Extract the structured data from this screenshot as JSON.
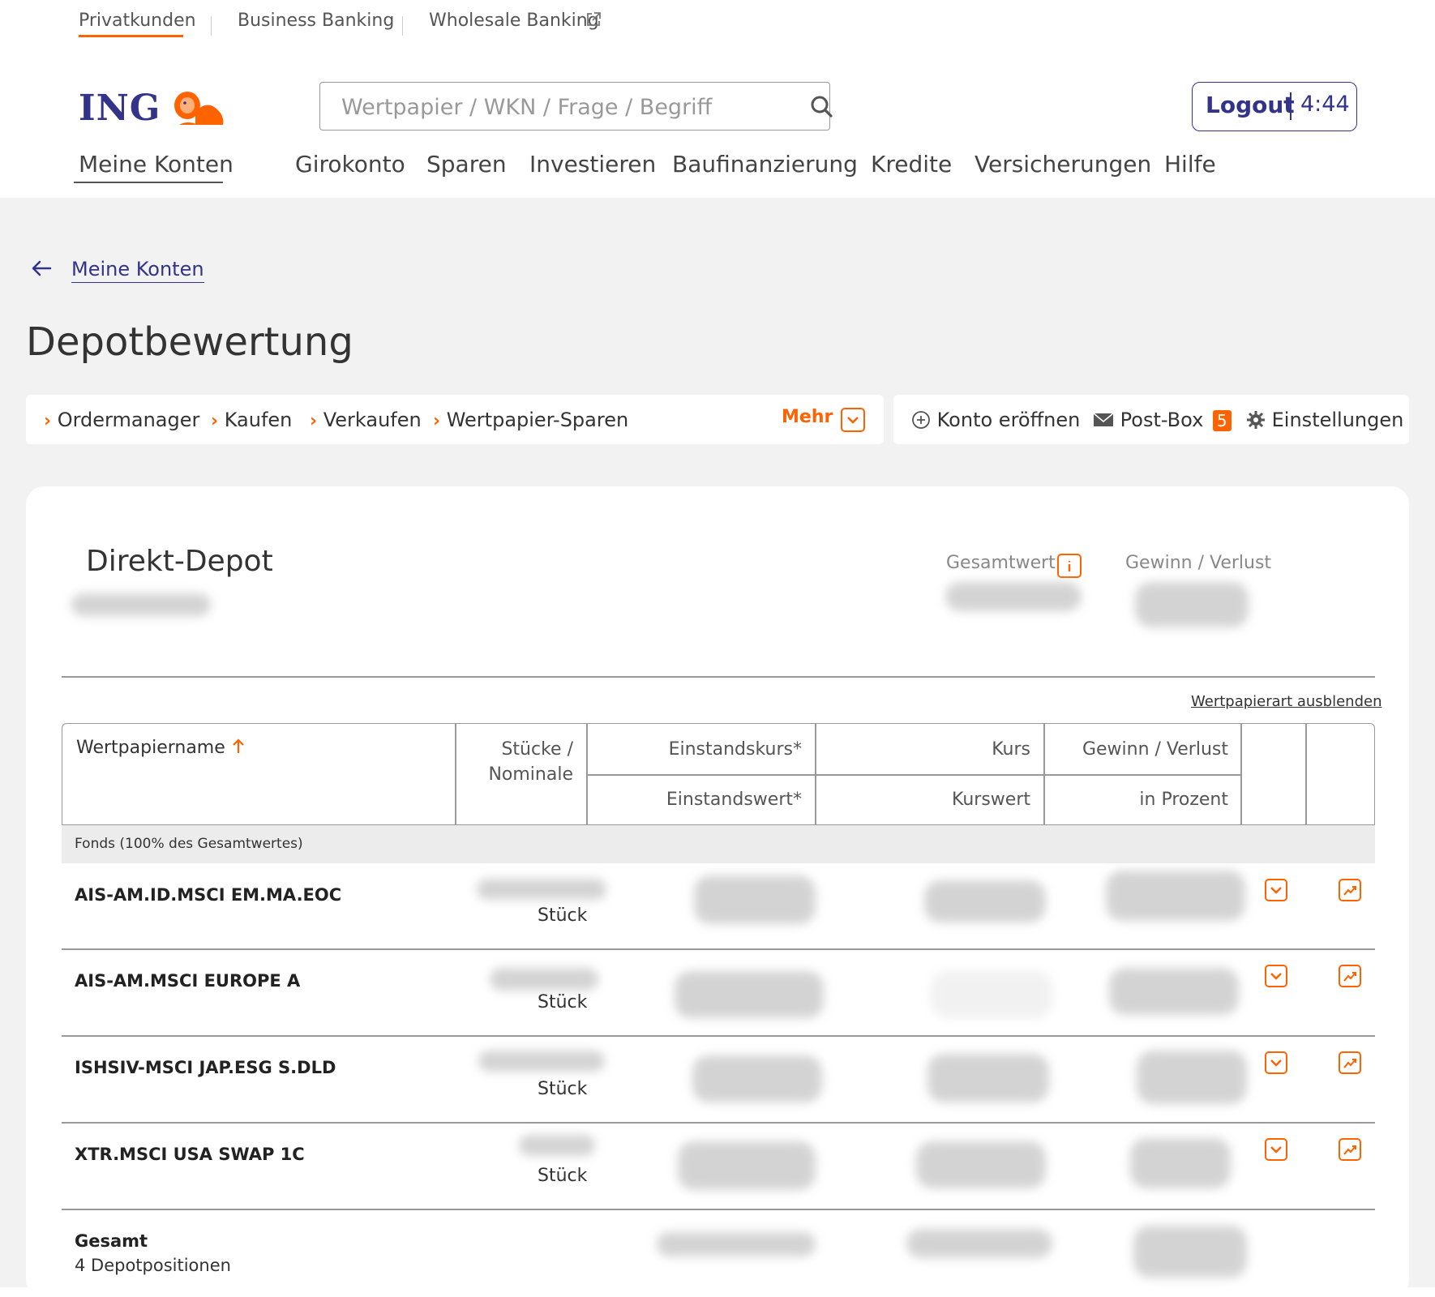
{
  "segments": {
    "privat": "Privatkunden",
    "business": "Business Banking",
    "wholesale": "Wholesale Banking"
  },
  "logo": {
    "text": "ING"
  },
  "search": {
    "placeholder": "Wertpapier / WKN / Frage / Begriff"
  },
  "logout": {
    "label": "Logout",
    "timer": "4:44"
  },
  "nav": {
    "meine_konten": "Meine Konten",
    "items": [
      "Girokonto",
      "Sparen",
      "Investieren",
      "Baufinanzierung",
      "Kredite",
      "Versicherungen",
      "Hilfe"
    ]
  },
  "breadcrumb": {
    "back_label": "Meine Konten"
  },
  "page_title": "Depotbewertung",
  "actions": {
    "items": [
      "Ordermanager",
      "Kaufen",
      "Verkaufen",
      "Wertpapier-Sparen"
    ],
    "more": "Mehr",
    "konto_eroeffnen": "Konto eröffnen",
    "postbox": "Post-Box",
    "postbox_count": "5",
    "einstellungen": "Einstellungen"
  },
  "depot": {
    "name": "Direkt-Depot",
    "gesamtwert_label": "Gesamtwert",
    "gewinn_label": "Gewinn / Verlust",
    "toggle_link": "Wertpapierart ausblenden"
  },
  "table": {
    "headers": {
      "name": "Wertpapiername",
      "stuecke": "Stücke /",
      "nominale": "Nominale",
      "einstandskurs": "Einstandskurs*",
      "einstandswert": "Einstandswert*",
      "kurs": "Kurs",
      "kurswert": "Kurswert",
      "gewinn": "Gewinn / Verlust",
      "prozent": "in Prozent"
    },
    "group_label": "Fonds (100% des Gesamtwertes)",
    "rows": [
      {
        "name": "AIS-AM.ID.MSCI EM.MA.EOC",
        "unit": "Stück"
      },
      {
        "name": "AIS-AM.MSCI EUROPE A",
        "unit": "Stück"
      },
      {
        "name": "ISHSIV-MSCI JAP.ESG S.DLD",
        "unit": "Stück"
      },
      {
        "name": "XTR.MSCI USA SWAP 1C",
        "unit": "Stück"
      }
    ],
    "total": {
      "label": "Gesamt",
      "sub": "4 Depotpositionen"
    }
  },
  "colors": {
    "accent": "#ff6200",
    "brand": "#33338a",
    "background": "#f2f2f2"
  }
}
